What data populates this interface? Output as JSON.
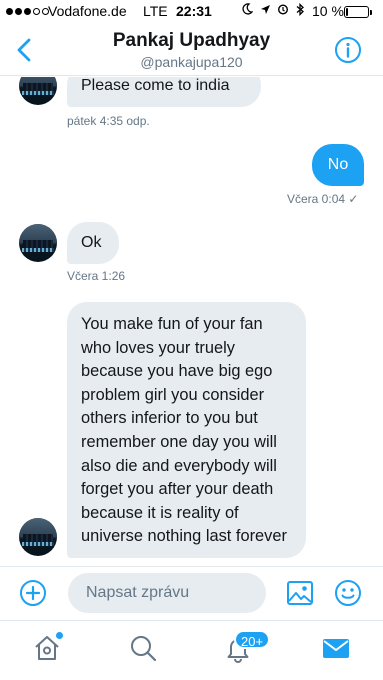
{
  "status_bar": {
    "carrier": "Vodafone.de",
    "network": "LTE",
    "time": "22:31",
    "battery_percent": "10 %",
    "battery_level": 0.1,
    "signal_bars_filled": 3,
    "signal_bars_total": 5
  },
  "header": {
    "name": "Pankaj Upadhyay",
    "handle": "@pankajupa120",
    "back_icon": "chevron-left-icon",
    "info_icon": "info-icon"
  },
  "messages": [
    {
      "direction": "in",
      "text": "Please come to india",
      "time": "pátek 4:35 odp."
    },
    {
      "direction": "out",
      "text": "No",
      "time": "Včera 0:04 ✓"
    },
    {
      "direction": "in",
      "text": "Ok",
      "time": "Včera 1:26"
    },
    {
      "direction": "in",
      "text": "You make fun of your fan who loves your truely because you have big ego problem girl you consider others inferior to you but remember one day you will also die and everybody will forget you after your death because it is reality of universe nothing last forever",
      "time": ""
    }
  ],
  "composer": {
    "placeholder": "Napsat zprávu",
    "value": ""
  },
  "tabbar": {
    "notification_badge": "20+"
  },
  "colors": {
    "accent": "#1da1f2",
    "bubble_in": "#e6ecf0",
    "secondary_text": "#657786"
  }
}
